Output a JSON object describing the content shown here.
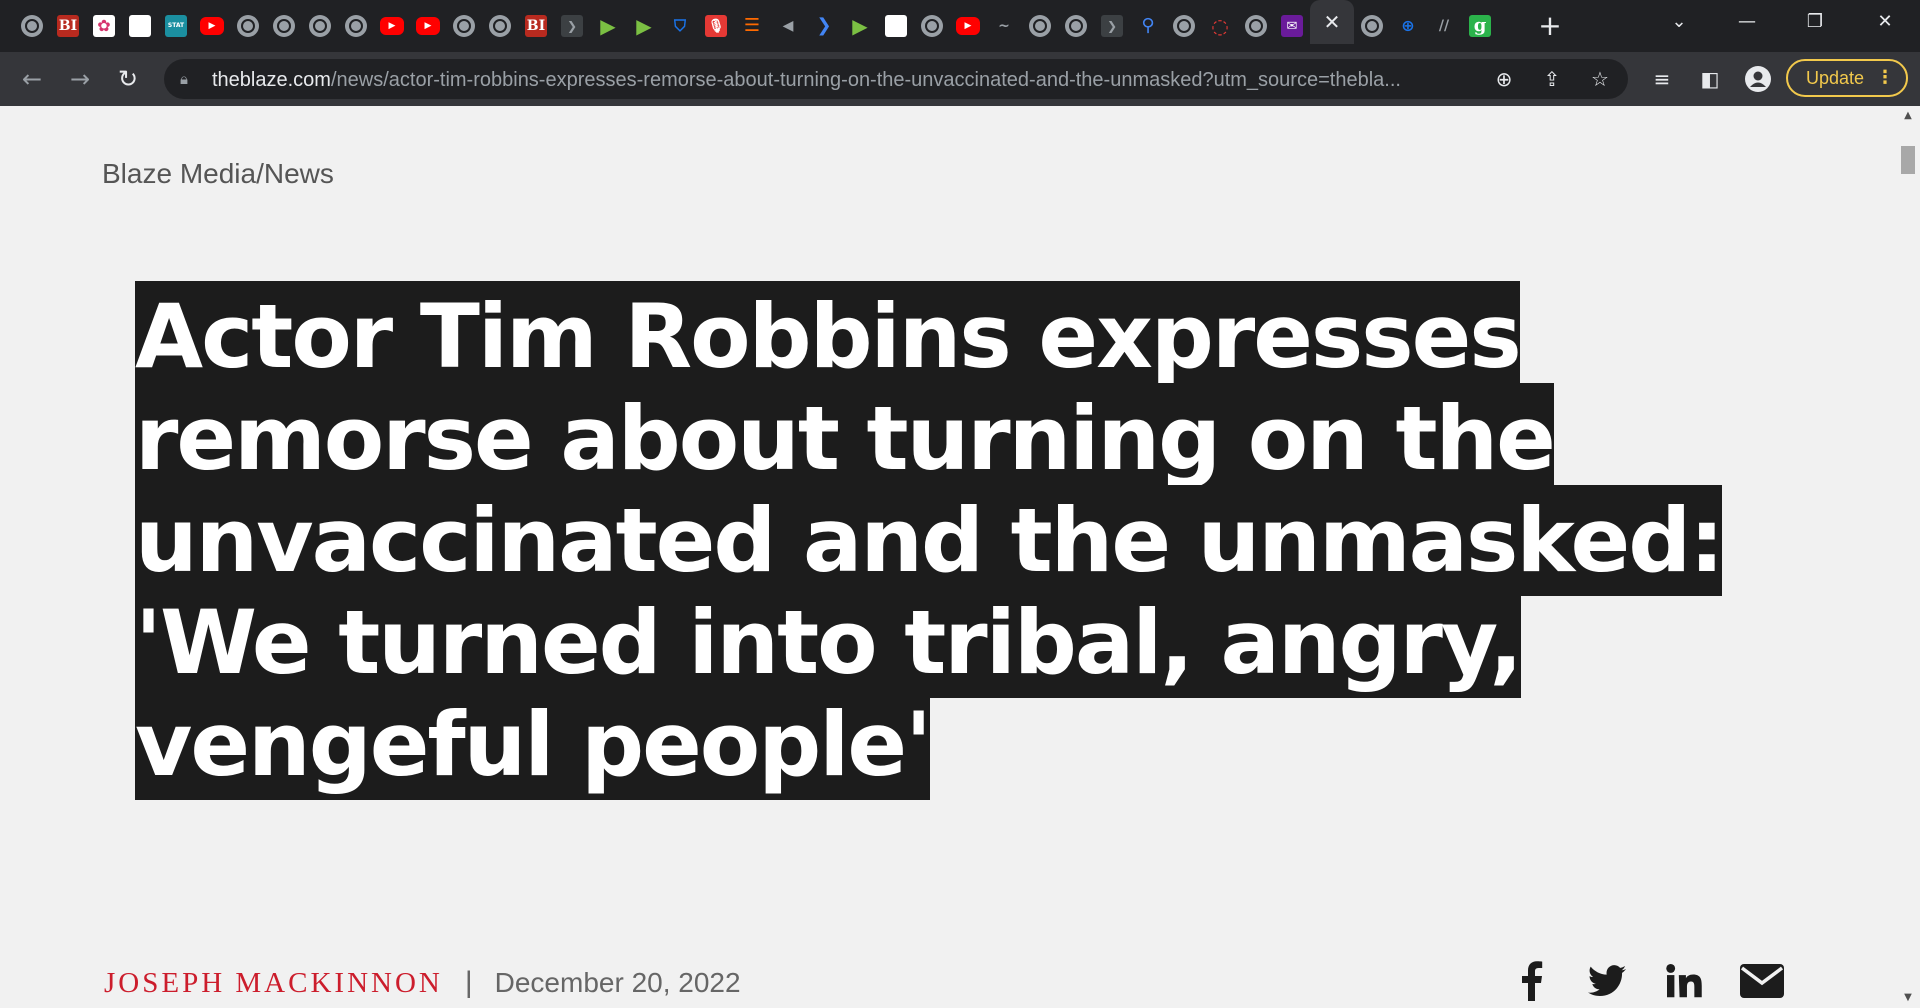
{
  "browser": {
    "tabs": [
      {
        "icon": "globe-icon",
        "style": "globe",
        "glyph": ""
      },
      {
        "icon": "bi-icon",
        "style": "bi",
        "glyph": "BI"
      },
      {
        "icon": "pinwheel-icon",
        "style": "pink",
        "glyph": "✿"
      },
      {
        "icon": "blank-page-icon",
        "style": "white",
        "glyph": ""
      },
      {
        "icon": "stat-icon",
        "style": "stat",
        "glyph": "STAT"
      },
      {
        "icon": "youtube-icon",
        "style": "yt",
        "glyph": "▶"
      },
      {
        "icon": "globe-icon",
        "style": "globe",
        "glyph": ""
      },
      {
        "icon": "globe-icon",
        "style": "globe",
        "glyph": ""
      },
      {
        "icon": "globe-icon",
        "style": "globe",
        "glyph": ""
      },
      {
        "icon": "globe-icon",
        "style": "globe",
        "glyph": ""
      },
      {
        "icon": "youtube-icon",
        "style": "yt",
        "glyph": "▶"
      },
      {
        "icon": "youtube-icon",
        "style": "yt",
        "glyph": "▶"
      },
      {
        "icon": "globe-icon",
        "style": "globe",
        "glyph": ""
      },
      {
        "icon": "globe-icon",
        "style": "globe",
        "glyph": ""
      },
      {
        "icon": "bi-icon",
        "style": "bi",
        "glyph": "BI"
      },
      {
        "icon": "arrow-tag-icon",
        "style": "dark",
        "glyph": "❯"
      },
      {
        "icon": "play-circle-icon",
        "style": "play",
        "glyph": "▶"
      },
      {
        "icon": "play-circle-icon",
        "style": "play",
        "glyph": "▶"
      },
      {
        "icon": "shield-icon",
        "style": "teal",
        "glyph": "⛉"
      },
      {
        "icon": "microphone-icon",
        "style": "redmic",
        "glyph": "🎙"
      },
      {
        "icon": "bookmark-stack-icon",
        "style": "orange",
        "glyph": "☰"
      },
      {
        "icon": "speaker-icon",
        "style": "grey",
        "glyph": "◀"
      },
      {
        "icon": "arrow-tag-icon",
        "style": "blue",
        "glyph": "❯"
      },
      {
        "icon": "play-circle-icon",
        "style": "play",
        "glyph": "▶"
      },
      {
        "icon": "grid-icon",
        "style": "white",
        "glyph": ""
      },
      {
        "icon": "globe-icon",
        "style": "globe",
        "glyph": ""
      },
      {
        "icon": "youtube-icon",
        "style": "yt",
        "glyph": "▶"
      },
      {
        "icon": "scribble-icon",
        "style": "grey",
        "glyph": "~"
      },
      {
        "icon": "globe-icon",
        "style": "globe",
        "glyph": ""
      },
      {
        "icon": "globe-icon",
        "style": "globe",
        "glyph": ""
      },
      {
        "icon": "arrow-tag-icon",
        "style": "dark",
        "glyph": "❯"
      },
      {
        "icon": "search-icon",
        "style": "blue",
        "glyph": "⚲"
      },
      {
        "icon": "globe-icon",
        "style": "globe",
        "glyph": ""
      },
      {
        "icon": "red-ring-icon",
        "style": "redring",
        "glyph": "◌"
      },
      {
        "icon": "globe-icon",
        "style": "globe",
        "glyph": ""
      },
      {
        "icon": "mail-icon",
        "style": "purple",
        "glyph": "✉"
      }
    ],
    "active_tab_close": "✕",
    "tabs_after": [
      {
        "icon": "globe-icon",
        "style": "globe",
        "glyph": ""
      },
      {
        "icon": "teal-logo-icon",
        "style": "teal",
        "glyph": "⊕"
      },
      {
        "icon": "slash-logo-icon",
        "style": "grey",
        "glyph": "//"
      },
      {
        "icon": "g-logo-icon",
        "style": "green-g",
        "glyph": "g"
      }
    ],
    "new_tab": "+",
    "window": {
      "menu": "⌄",
      "minimize": "—",
      "restore": "❐",
      "close": "✕"
    },
    "url_host": "theblaze.com",
    "url_path": "/news/actor-tim-robbins-expresses-remorse-about-turning-on-the-unvaccinated-and-the-unmasked?utm_source=thebla...",
    "update_label": "Update",
    "update_color": "#f2c94c"
  },
  "page": {
    "breadcrumb": "Blaze Media/News",
    "headline": "Actor Tim Robbins expresses remorse about turning on the unvaccinated and the unmasked: 'We turned into tribal, angry, vengeful people'",
    "author": "JOSEPH MACKINNON",
    "separator": "|",
    "date": "December 20, 2022",
    "share": [
      "facebook-icon",
      "twitter-icon",
      "linkedin-icon",
      "email-icon"
    ],
    "author_color": "#cc1d2c",
    "headline_bg": "#1c1c1c"
  }
}
